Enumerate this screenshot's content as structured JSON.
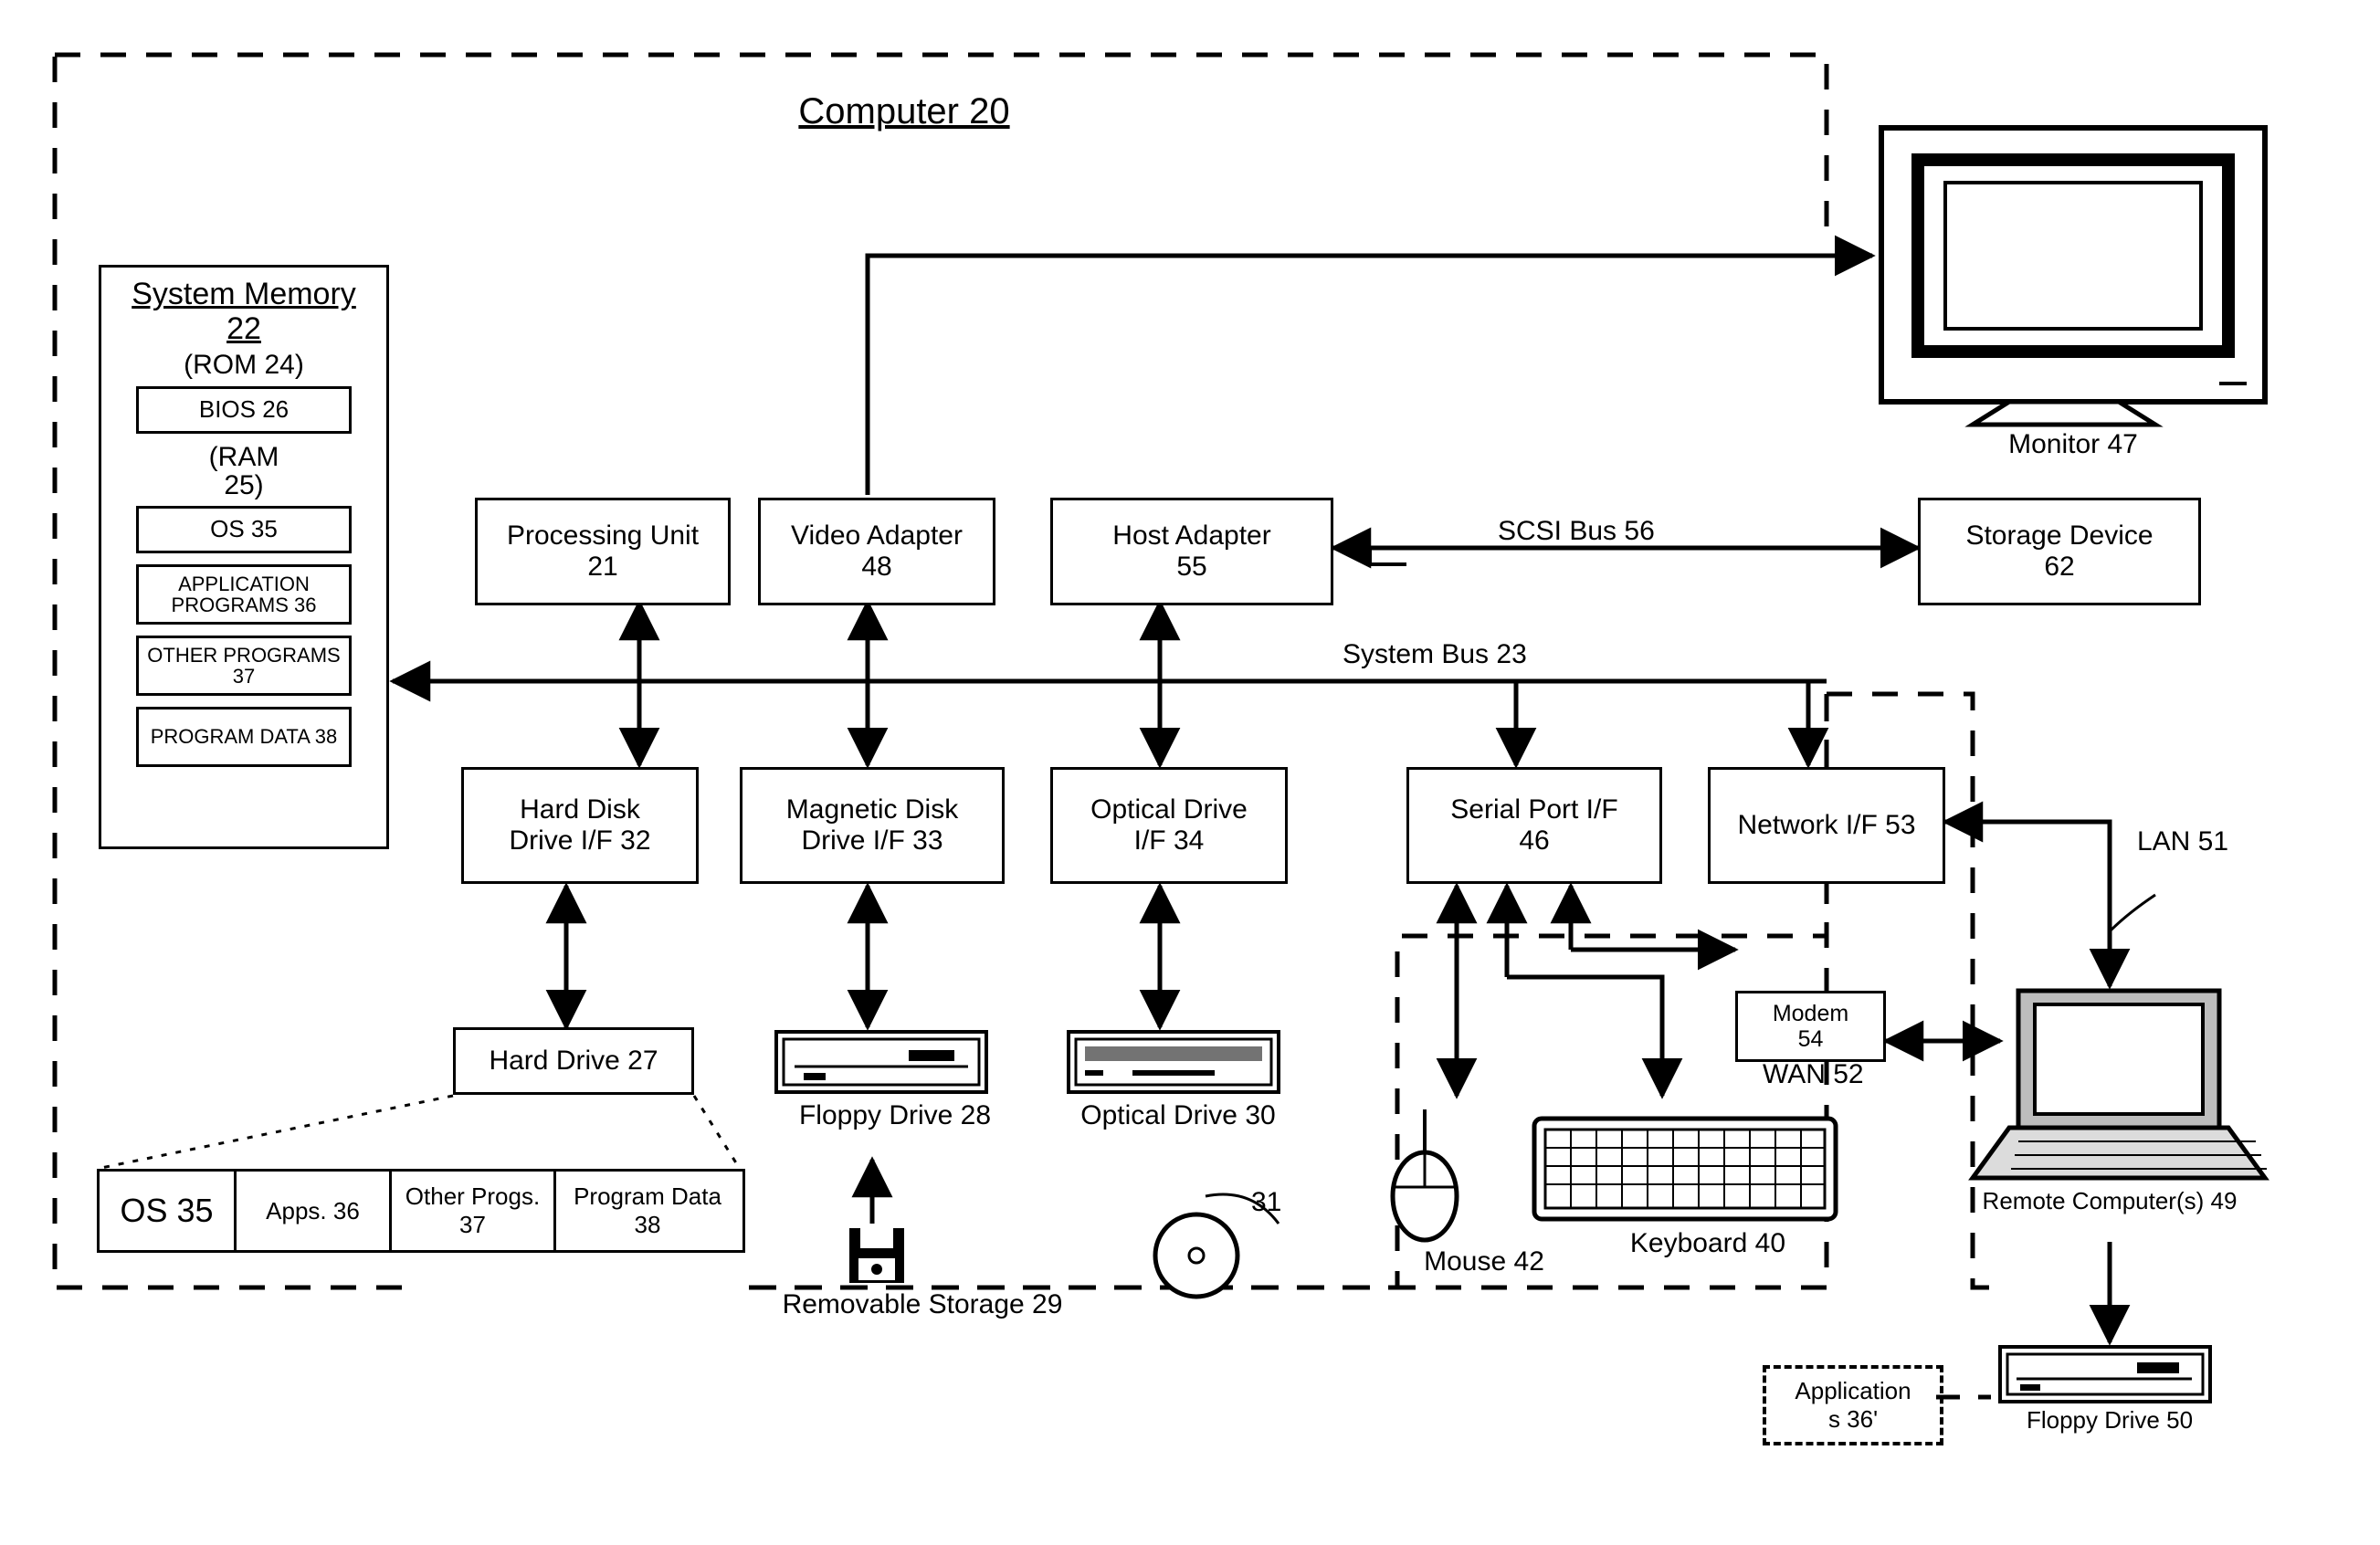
{
  "title": "Computer 20",
  "mem": {
    "title": "System Memory",
    "num": "22",
    "rom": "(ROM 24)",
    "bios": "BIOS 26",
    "ram": "(RAM 25)",
    "os": "OS 35",
    "apps": "APPLICATION PROGRAMS 36",
    "other": "OTHER PROGRAMS 37",
    "pdata": "PROGRAM DATA 38"
  },
  "pu": {
    "l1": "Processing Unit",
    "l2": "21"
  },
  "va": {
    "l1": "Video Adapter",
    "l2": "48"
  },
  "ha": {
    "l1": "Host Adapter",
    "l2": "55"
  },
  "hdd": {
    "l1": "Hard Disk",
    "l2": "Drive I/F 32"
  },
  "mdd": {
    "l1": "Magnetic Disk",
    "l2": "Drive I/F 33"
  },
  "odd": {
    "l1": "Optical Drive",
    "l2": "I/F 34"
  },
  "sp": {
    "l1": "Serial Port I/F",
    "l2": "46"
  },
  "net": {
    "l1": "Network I/F 53"
  },
  "modem": {
    "l1": "Modem",
    "l2": "54"
  },
  "sd": {
    "l1": "Storage Device",
    "l2": "62"
  },
  "apps2": {
    "l1": "Application",
    "l2": "s 36'"
  },
  "monitor": "Monitor 47",
  "scsi": "SCSI Bus 56",
  "sysbus": "System Bus 23",
  "harddrive": "Hard Drive 27",
  "hd_os": "OS 35",
  "hd_apps": "Apps. 36",
  "hd_other": "Other Progs. 37",
  "hd_pd": "Program Data 38",
  "floppy": "Floppy Drive 28",
  "optdrive": "Optical Drive 30",
  "removable": "Removable Storage 29",
  "disc31": "31",
  "mouse": "Mouse 42",
  "keyboard": "Keyboard 40",
  "wan": "WAN 52",
  "lan": "LAN 51",
  "remote": "Remote Computer(s) 49",
  "floppy50": "Floppy Drive 50"
}
